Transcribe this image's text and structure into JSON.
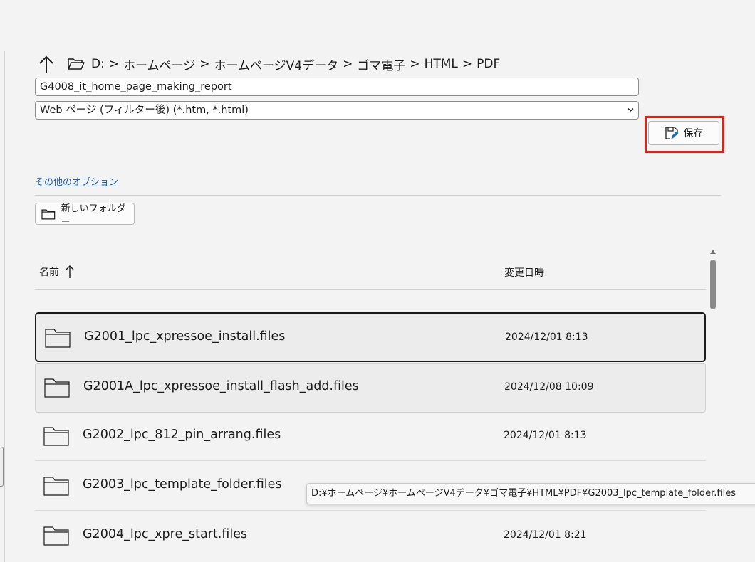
{
  "nav": {
    "up_icon": "arrow-up-icon",
    "folder_icon": "folder-open-icon",
    "breadcrumb": [
      "D:",
      "ホームページ",
      "ホームページV4データ",
      "ゴマ電子",
      "HTML",
      "PDF"
    ],
    "separator": ">"
  },
  "form": {
    "filename_value": "G4008_it_home_page_making_report",
    "filetype_value": "Web ページ (フィルター後) (*.htm, *.html)",
    "save_label": "保存",
    "highlight_color": "#e0201a"
  },
  "options": {
    "more_options_label": "その他のオプション",
    "new_folder_label": "新しいフォルダー"
  },
  "list": {
    "columns": {
      "name": "名前",
      "modified": "変更日時"
    },
    "sort": "ascending",
    "rows": [
      {
        "name": "G2001_lpc_xpressoe_install.files",
        "date": "2024/12/01 8:13"
      },
      {
        "name": "G2001A_lpc_xpressoe_install_flash_add.files",
        "date": "2024/12/08 10:09"
      },
      {
        "name": "G2002_lpc_812_pin_arrang.files",
        "date": "2024/12/01 8:13"
      },
      {
        "name": "G2003_lpc_template_folder.files",
        "date": ""
      },
      {
        "name": "G2004_lpc_xpre_start.files",
        "date": "2024/12/01 8:21"
      }
    ]
  },
  "tooltip": {
    "text": "D:¥ホームページ¥ホームページV4データ¥ゴマ電子¥HTML¥PDF¥G2003_lpc_template_folder.files"
  }
}
